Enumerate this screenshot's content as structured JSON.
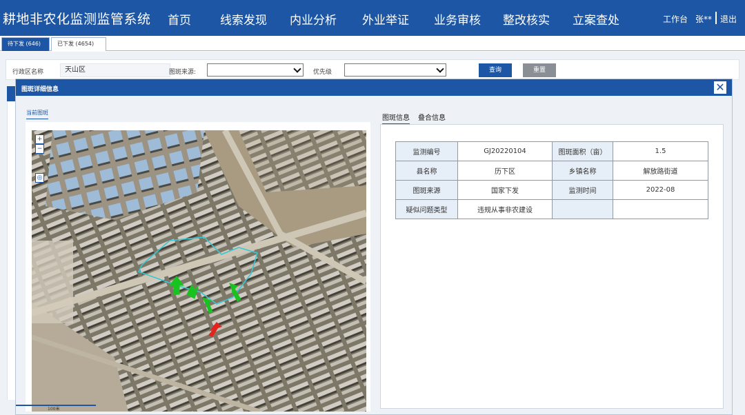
{
  "app": {
    "title": "耕地非农化监测监管系统"
  },
  "nav": [
    {
      "label": "首页"
    },
    {
      "label": "线索发现"
    },
    {
      "label": "内业分析"
    },
    {
      "label": "外业举证"
    },
    {
      "label": "业务审核"
    },
    {
      "label": "整改核实"
    },
    {
      "label": "立案查处"
    }
  ],
  "top_right": {
    "workbench": "工作台",
    "user": "张**",
    "logout": "退出"
  },
  "tabs": [
    {
      "label": "待下发 (646)"
    },
    {
      "label": "已下发 (4654)"
    }
  ],
  "filter": {
    "region_label": "行政区名称",
    "region_value": "天山区",
    "source_label": "图斑来源:",
    "source_value": "",
    "priority_label": "优先级",
    "priority_value": "",
    "query_button": "查询",
    "reset_button": "重置"
  },
  "modal": {
    "title": "图斑详细信息",
    "close_icon": "close-icon",
    "left_tab": "当前图斑",
    "map_scale": "100米",
    "right_tabs": [
      {
        "label": "图斑信息"
      },
      {
        "label": "叠合信息"
      }
    ],
    "info_rows": [
      {
        "k1": "监测编号",
        "v1": "GJ20220104",
        "k2": "图斑面积（亩）",
        "v2": "1.5"
      },
      {
        "k1": "县名称",
        "v1": "历下区",
        "k2": "乡镇名称",
        "v2": "解放路街道"
      },
      {
        "k1": "图斑来源",
        "v1": "国家下发",
        "k2": "监测时间",
        "v2": "2022-08"
      },
      {
        "k1": "疑似问题类型",
        "v1": "违规从事非农建设",
        "k2": "",
        "v2": ""
      }
    ]
  },
  "colors": {
    "primary": "#1d56a4",
    "reset": "#8a8f96",
    "polygon": "#38c7d4",
    "arrow_green": "#19c31f",
    "arrow_red": "#e3231d"
  }
}
